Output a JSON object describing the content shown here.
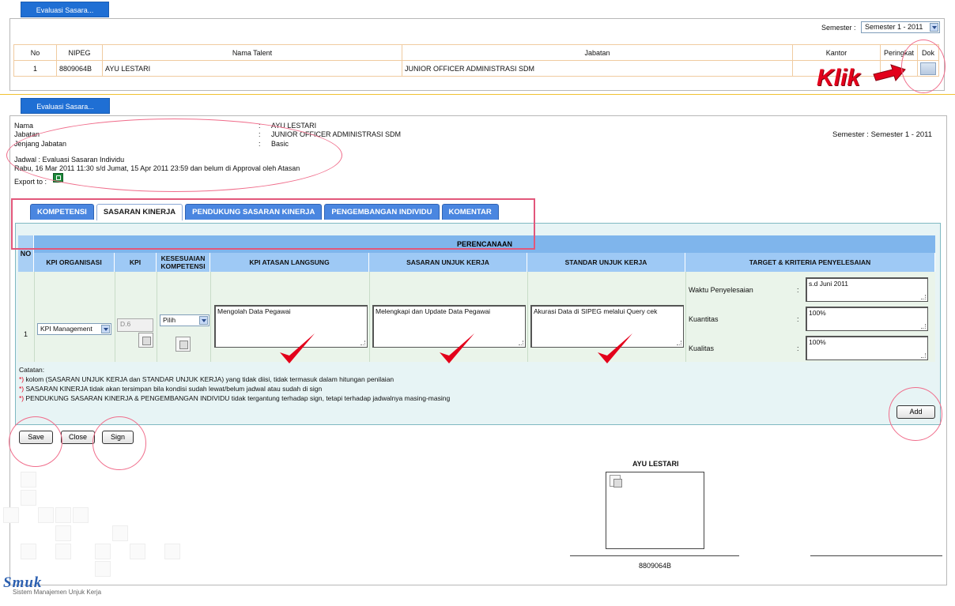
{
  "top_tab": "Evaluasi Sasara...",
  "main_tab": "Evaluasi Sasara...",
  "semester_label": "Semester :",
  "semester_value": "Semester 1 - 2011",
  "talent_table": {
    "headers": [
      "No",
      "NIPEG",
      "Nama Talent",
      "Jabatan",
      "Kantor",
      "Peringkat",
      "Dok"
    ],
    "row": [
      "1",
      "8809064B",
      "AYU LESTARI",
      "JUNIOR OFFICER ADMINISTRASI SDM",
      "",
      "",
      ""
    ]
  },
  "annotation_klik": "Klik",
  "profile": {
    "nama_label": "Nama",
    "nama_value": "AYU LESTARI",
    "jabatan_label": "Jabatan",
    "jabatan_value": "JUNIOR OFFICER ADMINISTRASI SDM",
    "jenjang_label": "Jenjang Jabatan",
    "jenjang_value": "Basic",
    "colon": ":",
    "semester_text": "Semester : Semester 1 - 2011"
  },
  "jadwal": {
    "line1": "Jadwal : Evaluasi Sasaran Individu",
    "line2": "Rabu, 16 Mar 2011 11:30 s/d Jumat, 15 Apr 2011 23:59 dan belum di Approval oleh Atasan",
    "export_label": "Export to :"
  },
  "tabs": [
    "KOMPETENSI",
    "SASARAN KINERJA",
    "PENDUKUNG SASARAN KINERJA",
    "PENGEMBANGAN INDIVIDU",
    "KOMENTAR"
  ],
  "grid": {
    "group_header": "PERENCANAAN",
    "no_header": "NO",
    "columns": [
      "KPI ORGANISASI",
      "KPI",
      "KESESUAIAN KOMPETENSI",
      "KPI ATASAN LANGSUNG",
      "SASARAN UNJUK KERJA",
      "STANDAR UNJUK KERJA",
      "TARGET & KRITERIA PENYELESAIAN"
    ],
    "row": {
      "no": "1",
      "kpi_organisasi": "KPI Management",
      "kpi": "D.6",
      "kesesuaian": "Pilih",
      "kpi_atasan": "Mengolah Data Pegawai",
      "sasaran": "Melengkapi dan Update Data Pegawai",
      "standar": "Akurasi Data di SIPEG melalui Query cek",
      "target": [
        {
          "label": "Waktu Penyelesaian",
          "value": "s.d Juni 2011"
        },
        {
          "label": "Kuantitas",
          "value": "100%"
        },
        {
          "label": "Kualitas",
          "value": "100%"
        }
      ]
    }
  },
  "notes": {
    "title": "Catatan:",
    "items": [
      "kolom (SASARAN UNJUK KERJA dan STANDAR UNJUK KERJA) yang tidak diisi, tidak termasuk dalam hitungan penilaian",
      "SASARAN KINERJA tidak akan tersimpan bila kondisi sudah lewat/belum jadwal atau sudah di sign",
      "PENDUKUNG SASARAN KINERJA & PENGEMBANGAN INDIVIDU tidak tergantung terhadap sign, tetapi terhadap jadwalnya masing-masing"
    ],
    "star": "*)"
  },
  "buttons": {
    "add": "Add",
    "save": "Save",
    "close": "Close",
    "sign": "Sign"
  },
  "signature": {
    "name": "AYU LESTARI",
    "nipeg": "8809064B"
  },
  "logo": {
    "text": "Smuk",
    "subtitle": "Sistem Manajemen Unjuk Kerja"
  },
  "colors": {
    "accent_blue": "#1f6fd4",
    "annotation_red": "#e3001b",
    "highlight_pink": "#e2577b"
  }
}
